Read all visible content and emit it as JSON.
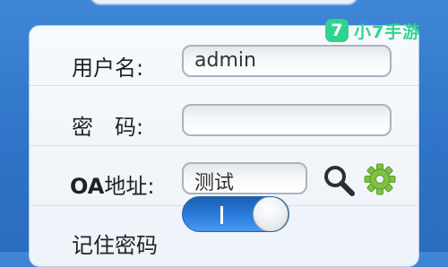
{
  "form": {
    "username_label": "用户名:",
    "username_value": "admin",
    "password_label": "密　码:",
    "password_value": "",
    "oa_label_prefix": "OA",
    "oa_label_suffix": "地址:",
    "oa_value": "测试",
    "remember_label": "记住密码",
    "remember_on": true
  },
  "icons": {
    "search": "search-icon",
    "settings": "gear-icon"
  },
  "watermark": {
    "badge": "7",
    "text": "小7手游"
  },
  "colors": {
    "background": "#2f74c8",
    "toggle_on": "#2d7fe0",
    "gear": "#7fc241",
    "watermark": "#2fd38d"
  }
}
